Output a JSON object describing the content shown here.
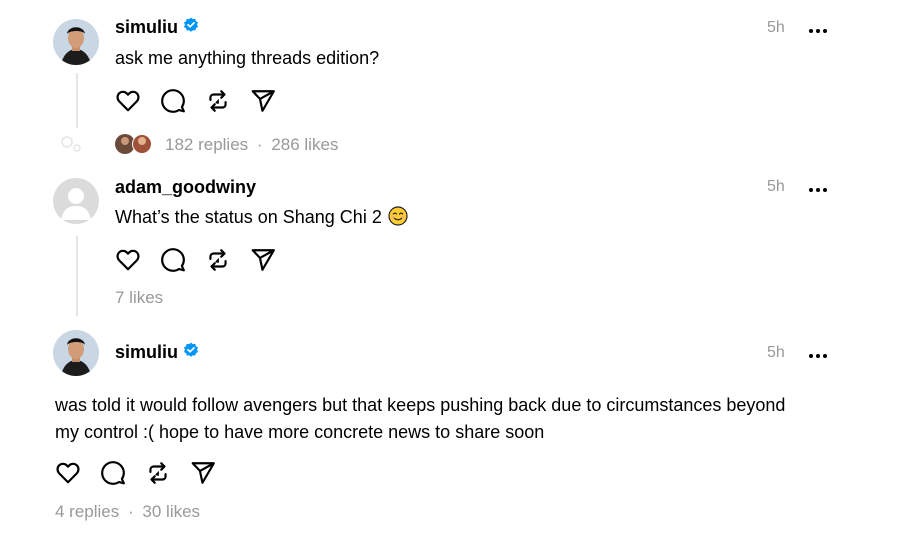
{
  "posts": [
    {
      "username": "simuliu",
      "verified": true,
      "time": "5h",
      "text": "ask me anything threads edition?",
      "replies": "182 replies",
      "separator": "·",
      "likes": "286 likes"
    },
    {
      "username": "adam_goodwiny",
      "verified": false,
      "time": "5h",
      "text": "What’s the status on Shang Chi 2",
      "emoji": "smiling-face-emoji",
      "likes": "7 likes"
    },
    {
      "username": "simuliu",
      "verified": true,
      "time": "5h",
      "text_line1": "was told it would follow avengers but that keeps pushing back due to circumstances beyond",
      "text_line2": "my control :( hope to have more concrete news to share soon",
      "replies": "4 replies",
      "separator": "·",
      "likes": "30 likes"
    }
  ],
  "icons": {
    "like": "heart-icon",
    "reply": "comment-icon",
    "repost": "repost-icon",
    "share": "send-icon",
    "more": "more-icon",
    "verified": "verified-badge-icon"
  },
  "colors": {
    "verified_blue": "#0095f6",
    "muted_text": "#999999",
    "thread_line": "#e5e5e5"
  }
}
